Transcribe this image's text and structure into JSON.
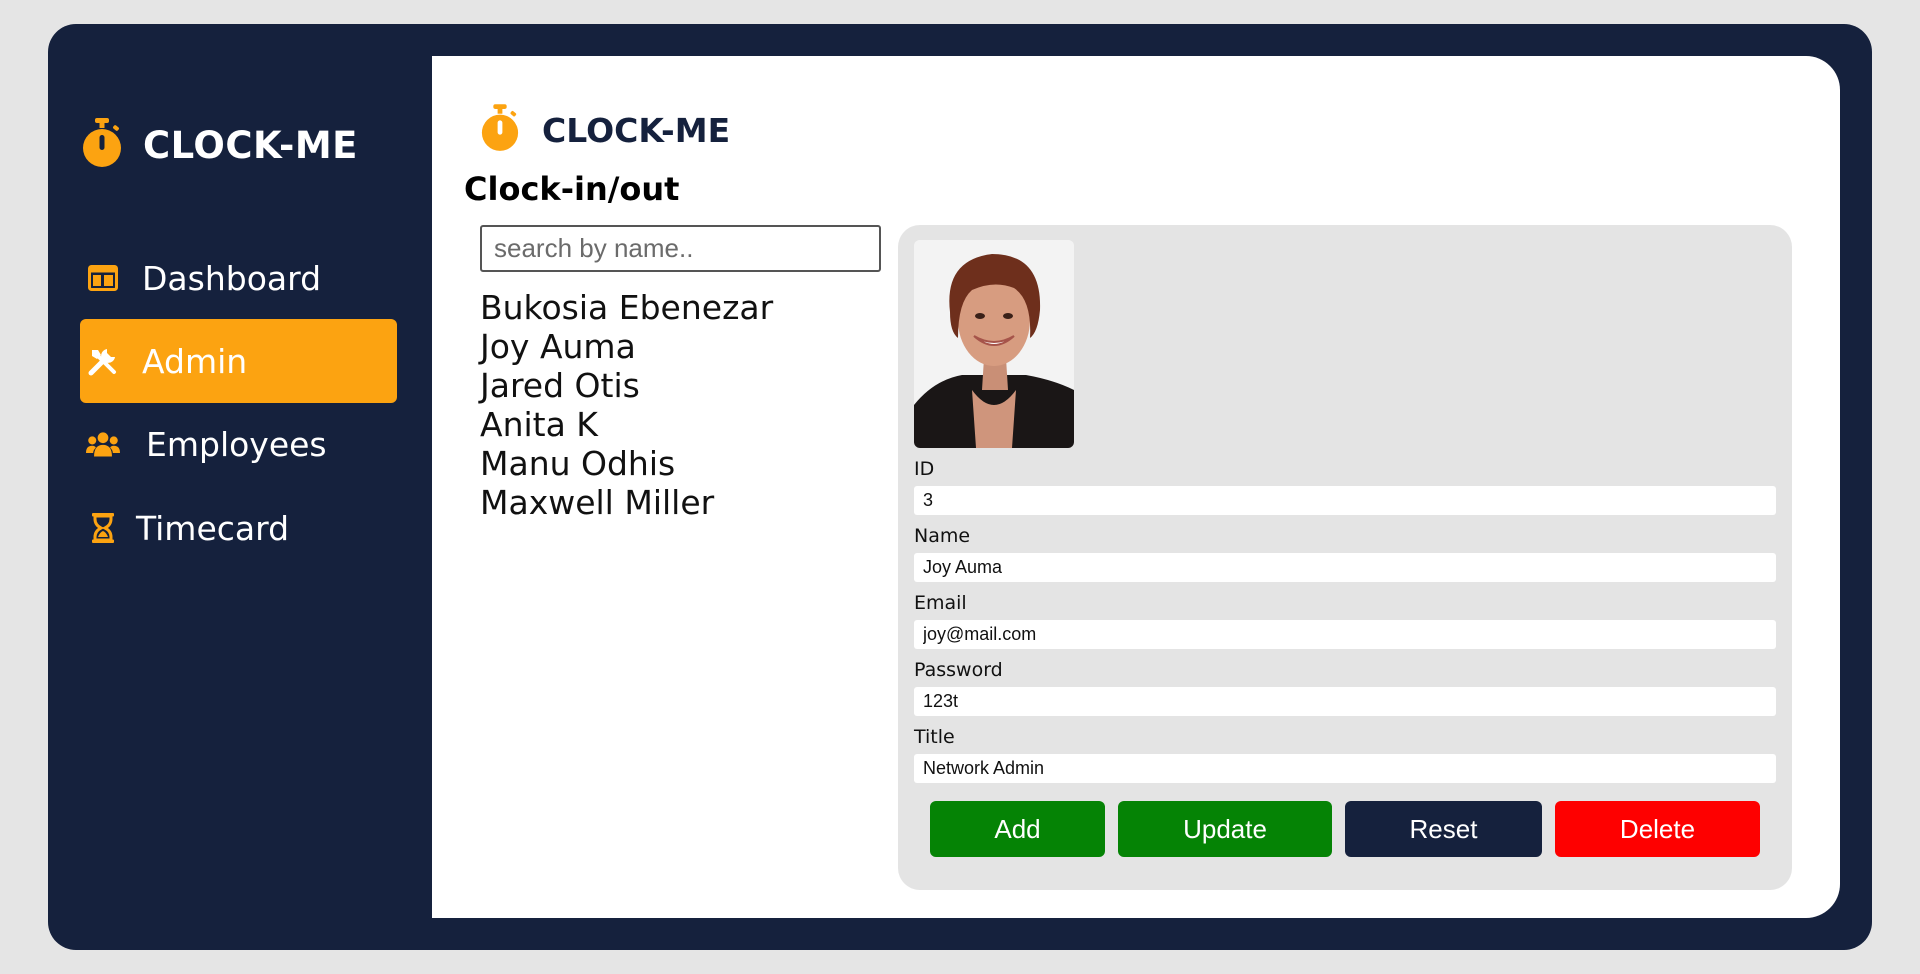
{
  "brand": {
    "name": "CLOCK-ME",
    "accent": "#fca311",
    "navy": "#15213d"
  },
  "sidebar": {
    "items": [
      {
        "label": "Dashboard",
        "icon": "dashboard-icon",
        "active": false
      },
      {
        "label": "Admin",
        "icon": "tools-icon",
        "active": true
      },
      {
        "label": "Employees",
        "icon": "users-icon",
        "active": false
      },
      {
        "label": "Timecard",
        "icon": "hourglass-icon",
        "active": false
      }
    ]
  },
  "main": {
    "title": "Clock-in/out",
    "search": {
      "placeholder": "search by name..",
      "value": ""
    },
    "employees": [
      "Bukosia Ebenezar",
      "Joy Auma",
      "Jared Otis",
      "Anita K",
      "Manu Odhis",
      "Maxwell Miller"
    ]
  },
  "detail": {
    "fields": {
      "id": {
        "label": "ID",
        "value": "3"
      },
      "name": {
        "label": "Name",
        "value": "Joy Auma"
      },
      "email": {
        "label": "Email",
        "value": "joy@mail.com"
      },
      "password": {
        "label": "Password",
        "value": "123t"
      },
      "title": {
        "label": "Title",
        "value": "Network Admin"
      }
    },
    "buttons": {
      "add": "Add",
      "update": "Update",
      "reset": "Reset",
      "delete": "Delete"
    },
    "button_colors": {
      "add": "#058305",
      "update": "#058305",
      "reset": "#15213d",
      "delete": "#fe0000"
    }
  }
}
